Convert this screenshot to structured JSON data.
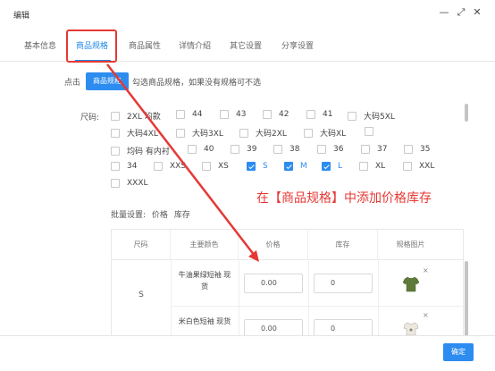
{
  "window": {
    "title": "编辑",
    "minimize_icon": "minimize-icon",
    "maximize_icon": "maximize-icon",
    "close_icon": "close-icon",
    "minimize_glyph": "—",
    "maximize_glyph": "⤢",
    "close_glyph": "✕"
  },
  "tabs": [
    {
      "label": "基本信息",
      "active": false
    },
    {
      "label": "商品规格",
      "active": true
    },
    {
      "label": "商品属性",
      "active": false
    },
    {
      "label": "详情介绍",
      "active": false
    },
    {
      "label": "其它设置",
      "active": false
    },
    {
      "label": "分享设置",
      "active": false
    }
  ],
  "spec_hint": {
    "prefix": "点击",
    "button_label": "商品规格",
    "text": "勾选商品规格，如果没有规格可不选"
  },
  "sizes": {
    "label": "尺码:",
    "options": [
      {
        "label": "2XL 均款",
        "checked": false
      },
      {
        "label": "44",
        "checked": false
      },
      {
        "label": "43",
        "checked": false
      },
      {
        "label": "42",
        "checked": false
      },
      {
        "label": "41",
        "checked": false
      },
      {
        "label": "大码5XL",
        "checked": false
      },
      {
        "label": "大码4XL",
        "checked": false
      },
      {
        "label": "大码3XL",
        "checked": false
      },
      {
        "label": "大码2XL",
        "checked": false
      },
      {
        "label": "大码XL",
        "checked": false
      },
      {
        "label": "",
        "checked": false
      },
      {
        "label": "均码 有内衬",
        "checked": false
      },
      {
        "label": "40",
        "checked": false
      },
      {
        "label": "39",
        "checked": false
      },
      {
        "label": "38",
        "checked": false
      },
      {
        "label": "36",
        "checked": false
      },
      {
        "label": "37",
        "checked": false
      },
      {
        "label": "35",
        "checked": false
      },
      {
        "label": "34",
        "checked": false
      },
      {
        "label": "XXS",
        "checked": false
      },
      {
        "label": "XS",
        "checked": false
      },
      {
        "label": "S",
        "checked": true
      },
      {
        "label": "M",
        "checked": true
      },
      {
        "label": "L",
        "checked": true
      },
      {
        "label": "XL",
        "checked": false
      },
      {
        "label": "XXL",
        "checked": false
      },
      {
        "label": "XXXL",
        "checked": false
      }
    ]
  },
  "batch": {
    "prefix": "批量设置:",
    "price": "价格",
    "stock": "库存"
  },
  "annotation": "在【商品规格】中添加价格库存",
  "table": {
    "headers": [
      "尺码",
      "主要颜色",
      "价格",
      "库存",
      "规格图片"
    ],
    "size": "S",
    "rows": [
      {
        "color": "牛油果绿短袖 现货",
        "price": "0.00",
        "stock": "0",
        "thumb_icon": "green-tshirt-icon",
        "delete_glyph": "×"
      },
      {
        "color": "米白色短袖 现货",
        "price": "0.00",
        "stock": "0",
        "thumb_icon": "white-tshirt-icon",
        "delete_glyph": "×"
      }
    ]
  },
  "footer": {
    "ok_label": "确定"
  },
  "colors": {
    "accent": "#2d8cf0",
    "annotation_red": "#e53935",
    "green_shirt": "#5e7a3a",
    "white_shirt": "#ece8e0"
  }
}
